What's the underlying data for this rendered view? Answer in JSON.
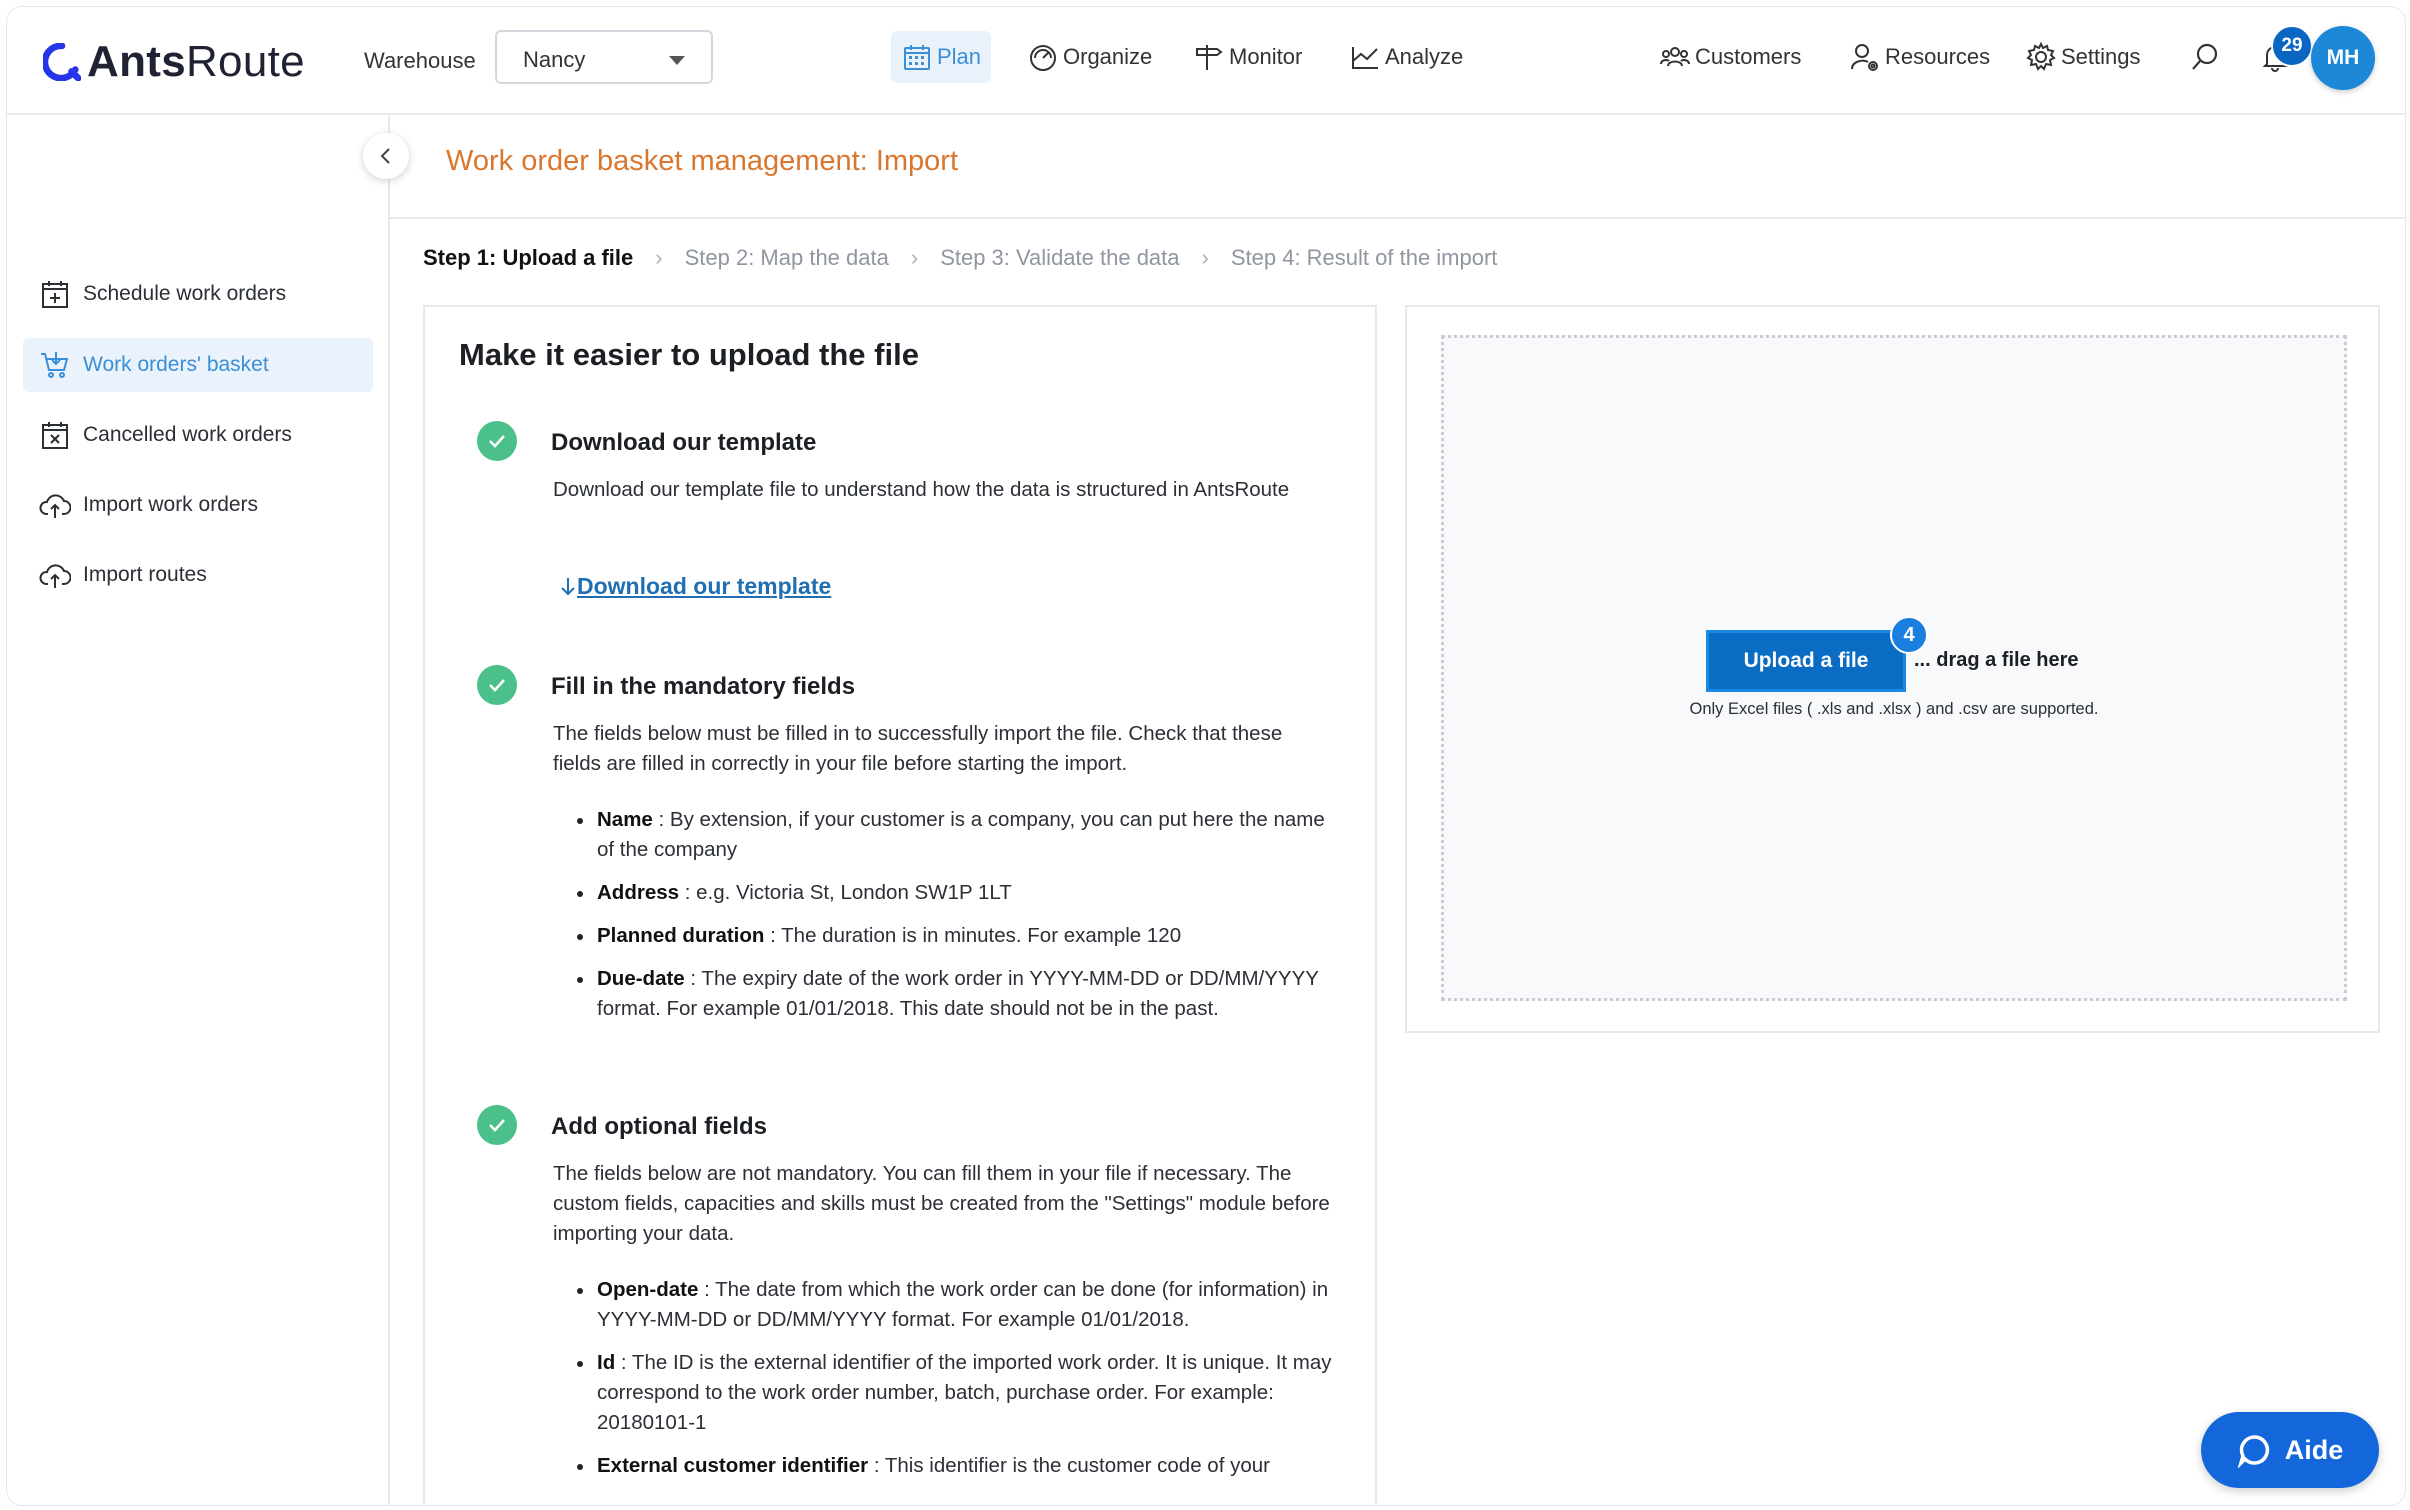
{
  "app": {
    "logo_prefix": "Ants",
    "logo_suffix": "Route"
  },
  "header": {
    "warehouse_label": "Warehouse",
    "warehouse_value": "Nancy",
    "nav": [
      {
        "label": "Plan",
        "icon": "calendar-icon",
        "active": true
      },
      {
        "label": "Organize",
        "icon": "gauge-icon"
      },
      {
        "label": "Monitor",
        "icon": "signpost-icon"
      },
      {
        "label": "Analyze",
        "icon": "chart-icon"
      }
    ],
    "right_nav": [
      {
        "label": "Customers",
        "icon": "users-icon"
      },
      {
        "label": "Resources",
        "icon": "user-gear-icon"
      },
      {
        "label": "Settings",
        "icon": "gear-icon"
      }
    ],
    "notifications_count": "29",
    "avatar_initials": "MH"
  },
  "sidebar": {
    "items": [
      {
        "label": "Schedule work orders",
        "icon": "calendar-plus-icon"
      },
      {
        "label": "Work orders' basket",
        "icon": "basket-icon",
        "active": true
      },
      {
        "label": "Cancelled work orders",
        "icon": "calendar-x-icon"
      },
      {
        "label": "Import work orders",
        "icon": "cloud-upload-icon"
      },
      {
        "label": "Import routes",
        "icon": "cloud-upload-icon"
      }
    ]
  },
  "page": {
    "title": "Work order basket management: Import",
    "steps": [
      "Step 1: Upload a file",
      "Step 2: Map the data",
      "Step 3: Validate the data",
      "Step 4: Result of the import"
    ]
  },
  "guide": {
    "title": "Make it easier to upload the file",
    "download": {
      "title": "Download our template",
      "text": "Download our template file to understand how the data is structured in AntsRoute",
      "link": "Download our template"
    },
    "mandatory": {
      "title": "Fill in the mandatory fields",
      "text": "The fields below must be filled in to successfully import the file. Check that these fields are filled in correctly in your file before starting the import.",
      "items": [
        {
          "name": "Name",
          "desc": " : By extension, if your customer is a company, you can put here the name of the company"
        },
        {
          "name": "Address",
          "desc": " : e.g. Victoria St, London SW1P 1LT"
        },
        {
          "name": "Planned duration",
          "desc": " : The duration is in minutes. For example 120"
        },
        {
          "name": "Due-date",
          "desc": " : The expiry date of the work order in YYYY-MM-DD or DD/MM/YYYY format. For example 01/01/2018. This date should not be in the past."
        }
      ]
    },
    "optional": {
      "title": "Add optional fields",
      "text": "The fields below are not mandatory. You can fill them in your file if necessary. The custom fields, capacities and skills must be created from the \"Settings\" module before importing your data.",
      "items": [
        {
          "name": "Open-date",
          "desc": " : The date from which the work order can be done (for information) in YYYY-MM-DD or DD/MM/YYYY format. For example 01/01/2018."
        },
        {
          "name": "Id",
          "desc": " : The ID is the external identifier of the imported work order. It is unique. It may correspond to the work order number, batch, purchase order. For example: 20180101-1"
        },
        {
          "name": "External customer identifier",
          "desc": " : This identifier is the customer code of your"
        }
      ]
    }
  },
  "upload": {
    "button": "Upload a file",
    "badge": "4",
    "drag_text": "... drag a file here",
    "supported": "Only Excel files ( .xls and .xlsx ) and .csv are supported."
  },
  "help_button": "Aide"
}
